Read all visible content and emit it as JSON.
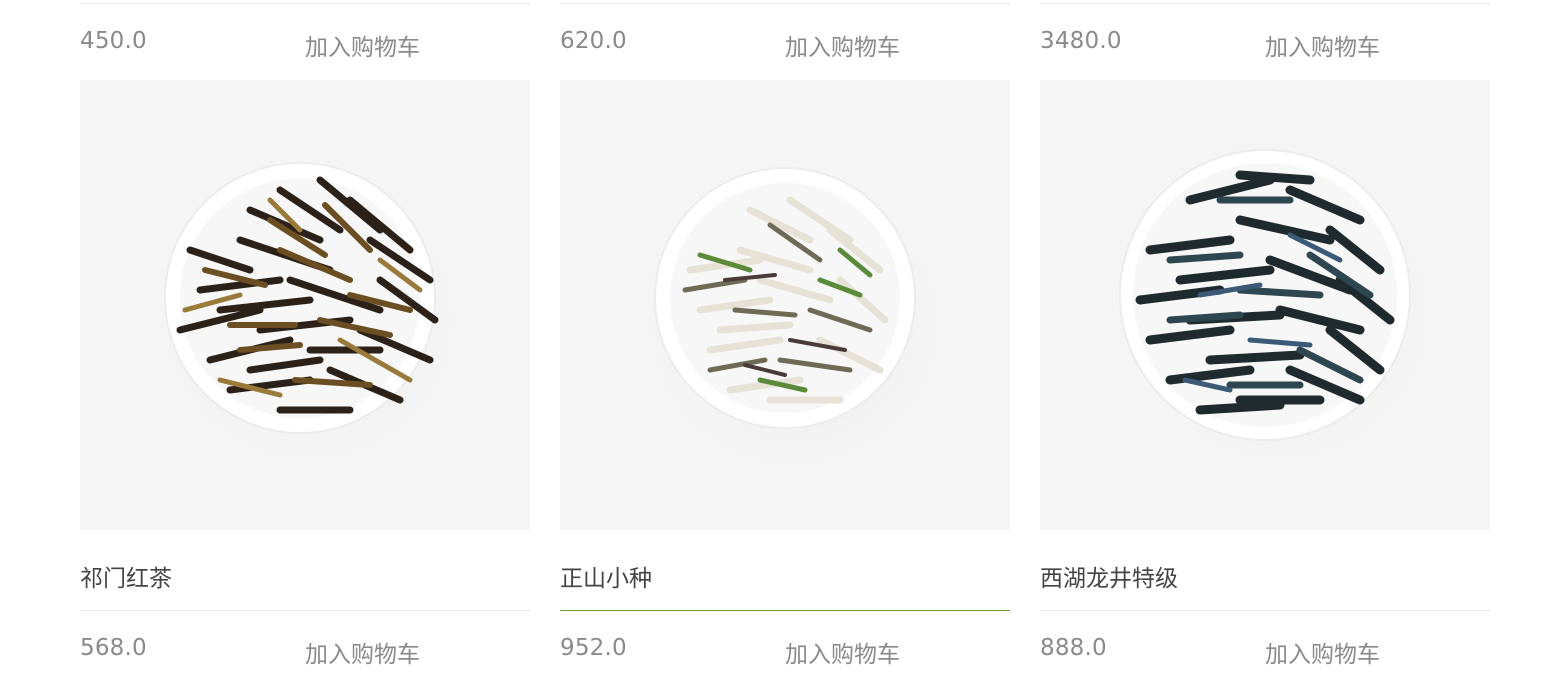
{
  "products_prev_row": [
    {
      "price": "450.0",
      "cart_label": "加入购物车"
    },
    {
      "price": "620.0",
      "cart_label": "加入购物车"
    },
    {
      "price": "3480.0",
      "cart_label": "加入购物车"
    }
  ],
  "products": [
    {
      "name": "祁门红茶",
      "price": "568.0",
      "cart_label": "加入购物车",
      "image": "tea-leaves-brown"
    },
    {
      "name": "正山小种",
      "price": "952.0",
      "cart_label": "加入购物车",
      "image": "tea-leaves-white"
    },
    {
      "name": "西湖龙井特级",
      "price": "888.0",
      "cart_label": "加入购物车",
      "image": "tea-leaves-dark"
    }
  ],
  "colors": {
    "accent_green": "#6e9a2e",
    "price_gray": "#8a8a8a",
    "divider": "#e6e6e6",
    "image_bg": "#f5f5f5"
  }
}
